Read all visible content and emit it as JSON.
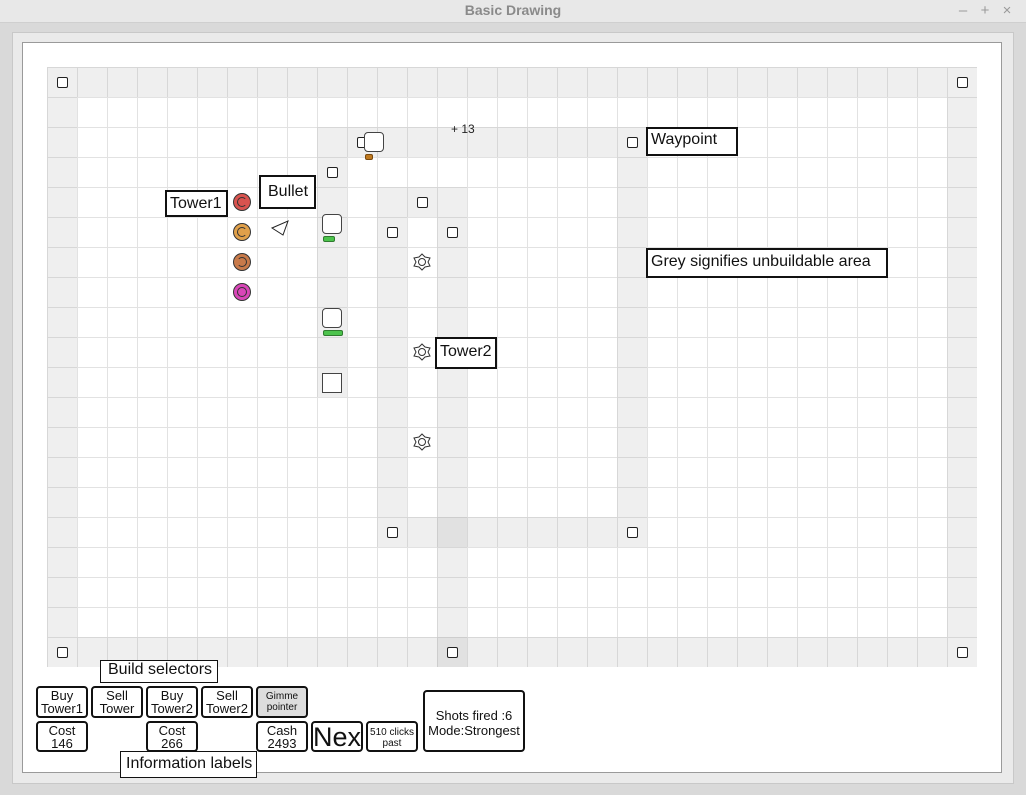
{
  "window": {
    "title": "Basic Drawing",
    "controls": [
      "–",
      "+",
      "×"
    ]
  },
  "annotations": {
    "tower1": "Tower1",
    "bullet": "Bullet",
    "waypoint": "Waypoint",
    "grey_note": "Grey signifies unbuildable area",
    "tower2": "Tower2",
    "build_selectors": "Build selectors",
    "info_labels": "Information labels"
  },
  "floating_text": "+ 13",
  "buttons": {
    "buy_tower1": "Buy\nTower1",
    "sell_tower": "Sell\nTower",
    "buy_tower2": "Buy\nTower2",
    "sell_tower2": "Sell\nTower2",
    "gimme_pointer": "Gimme\npointer"
  },
  "info": {
    "cost1": "Cost\n146",
    "cost2": "Cost\n266",
    "cash": "Cash\n2493",
    "next": "Next",
    "clicks": "510 clicks\npast",
    "shots": "Shots fired :6\nMode:Strongest"
  },
  "tower1_colors": [
    "#d9534f",
    "#e0a04a",
    "#c87a4a",
    "#d946b8"
  ],
  "enemy_health": [
    0.5,
    0.6,
    0.9
  ]
}
